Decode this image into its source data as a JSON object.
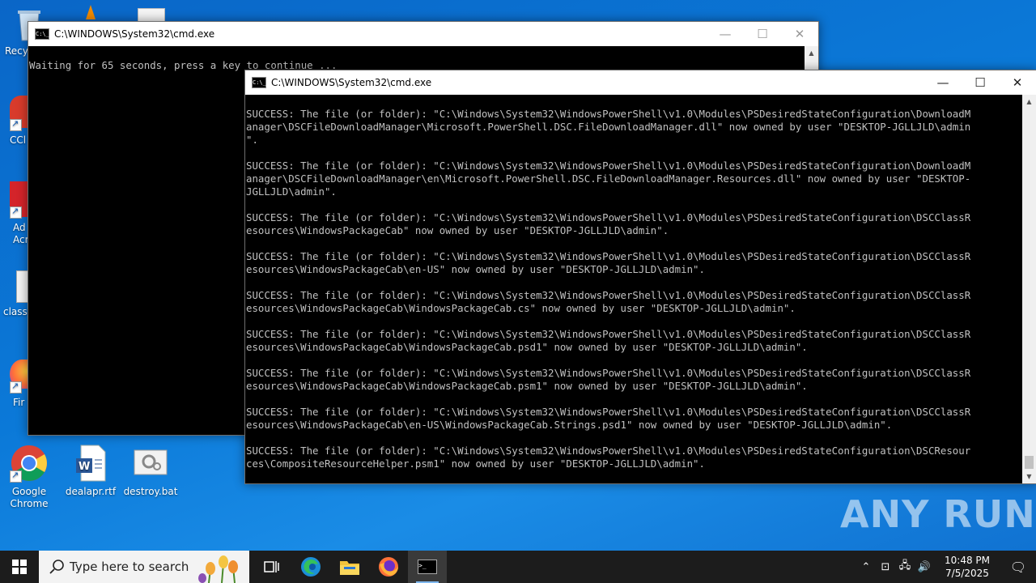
{
  "desktop": {
    "icons": [
      {
        "label": "Recy"
      },
      {
        "label": "CCl"
      },
      {
        "label": "Ad\nAcr"
      },
      {
        "label": "classv"
      },
      {
        "label": "Fir"
      },
      {
        "label": "Google\nChrome"
      },
      {
        "label": "dealapr.rtf"
      },
      {
        "label": "destroy.bat"
      }
    ]
  },
  "window_back": {
    "title": "C:\\WINDOWS\\System32\\cmd.exe",
    "text": "Waiting for 65 seconds, press a key to continue ..."
  },
  "window_front": {
    "title": "C:\\WINDOWS\\System32\\cmd.exe",
    "lines": [
      "SUCCESS: The file (or folder): \"C:\\Windows\\System32\\WindowsPowerShell\\v1.0\\Modules\\PSDesiredStateConfiguration\\DownloadM",
      "anager\\DSCFileDownloadManager\\Microsoft.PowerShell.DSC.FileDownloadManager.dll\" now owned by user \"DESKTOP-JGLLJLD\\admin",
      "\".",
      "",
      "SUCCESS: The file (or folder): \"C:\\Windows\\System32\\WindowsPowerShell\\v1.0\\Modules\\PSDesiredStateConfiguration\\DownloadM",
      "anager\\DSCFileDownloadManager\\en\\Microsoft.PowerShell.DSC.FileDownloadManager.Resources.dll\" now owned by user \"DESKTOP-",
      "JGLLJLD\\admin\".",
      "",
      "SUCCESS: The file (or folder): \"C:\\Windows\\System32\\WindowsPowerShell\\v1.0\\Modules\\PSDesiredStateConfiguration\\DSCClassR",
      "esources\\WindowsPackageCab\" now owned by user \"DESKTOP-JGLLJLD\\admin\".",
      "",
      "SUCCESS: The file (or folder): \"C:\\Windows\\System32\\WindowsPowerShell\\v1.0\\Modules\\PSDesiredStateConfiguration\\DSCClassR",
      "esources\\WindowsPackageCab\\en-US\" now owned by user \"DESKTOP-JGLLJLD\\admin\".",
      "",
      "SUCCESS: The file (or folder): \"C:\\Windows\\System32\\WindowsPowerShell\\v1.0\\Modules\\PSDesiredStateConfiguration\\DSCClassR",
      "esources\\WindowsPackageCab\\WindowsPackageCab.cs\" now owned by user \"DESKTOP-JGLLJLD\\admin\".",
      "",
      "SUCCESS: The file (or folder): \"C:\\Windows\\System32\\WindowsPowerShell\\v1.0\\Modules\\PSDesiredStateConfiguration\\DSCClassR",
      "esources\\WindowsPackageCab\\WindowsPackageCab.psd1\" now owned by user \"DESKTOP-JGLLJLD\\admin\".",
      "",
      "SUCCESS: The file (or folder): \"C:\\Windows\\System32\\WindowsPowerShell\\v1.0\\Modules\\PSDesiredStateConfiguration\\DSCClassR",
      "esources\\WindowsPackageCab\\WindowsPackageCab.psm1\" now owned by user \"DESKTOP-JGLLJLD\\admin\".",
      "",
      "SUCCESS: The file (or folder): \"C:\\Windows\\System32\\WindowsPowerShell\\v1.0\\Modules\\PSDesiredStateConfiguration\\DSCClassR",
      "esources\\WindowsPackageCab\\en-US\\WindowsPackageCab.Strings.psd1\" now owned by user \"DESKTOP-JGLLJLD\\admin\".",
      "",
      "SUCCESS: The file (or folder): \"C:\\Windows\\System32\\WindowsPowerShell\\v1.0\\Modules\\PSDesiredStateConfiguration\\DSCResour",
      "ces\\CompositeResourceHelper.psm1\" now owned by user \"DESKTOP-JGLLJLD\\admin\"."
    ]
  },
  "taskbar": {
    "search_placeholder": "Type here to search",
    "time": "10:48 PM",
    "date": "7/5/2025"
  },
  "watermark": "ANY RUN",
  "colors": {
    "desktop_blue": "#0b79d8",
    "terminal_bg": "#000000",
    "terminal_fg": "#c0c0c0",
    "taskbar": "#1c1c1c"
  }
}
